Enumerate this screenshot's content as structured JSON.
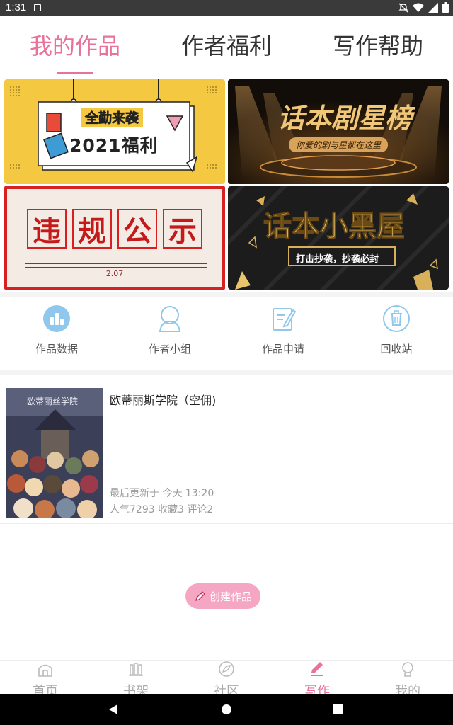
{
  "status": {
    "time": "1:31"
  },
  "tabs": [
    {
      "label": "我的作品"
    },
    {
      "label": "作者福利"
    },
    {
      "label": "写作帮助"
    }
  ],
  "banners": {
    "b1": {
      "line1": "全勤来袭",
      "line2": "2021福利"
    },
    "b2": {
      "title": "话本剧星榜",
      "sub": "你爱的剧与星都在这里"
    },
    "b3": {
      "chars": [
        "违",
        "规",
        "公",
        "示"
      ],
      "date": "2.07"
    },
    "b4": {
      "title": "话本小黑屋",
      "sub": "打击抄袭，抄袭必封"
    }
  },
  "quick": [
    {
      "label": "作品数据",
      "icon": "chart-icon"
    },
    {
      "label": "作者小组",
      "icon": "group-icon"
    },
    {
      "label": "作品申请",
      "icon": "edit-doc-icon"
    },
    {
      "label": "回收站",
      "icon": "trash-icon"
    }
  ],
  "work": {
    "title": "欧蒂丽斯学院（空佣)",
    "cover_title": "欧蒂丽丝学院",
    "updated": "最后更新于 今天 13:20",
    "stats": "人气7293 收藏3 评论2"
  },
  "create_button": "创建作品",
  "nav": [
    {
      "label": "首页",
      "icon": "home-icon"
    },
    {
      "label": "书架",
      "icon": "bookshelf-icon"
    },
    {
      "label": "社区",
      "icon": "community-icon"
    },
    {
      "label": "写作",
      "icon": "pen-icon"
    },
    {
      "label": "我的",
      "icon": "profile-icon"
    }
  ],
  "colors": {
    "accent": "#e8729a",
    "button": "#f4a6c2"
  }
}
